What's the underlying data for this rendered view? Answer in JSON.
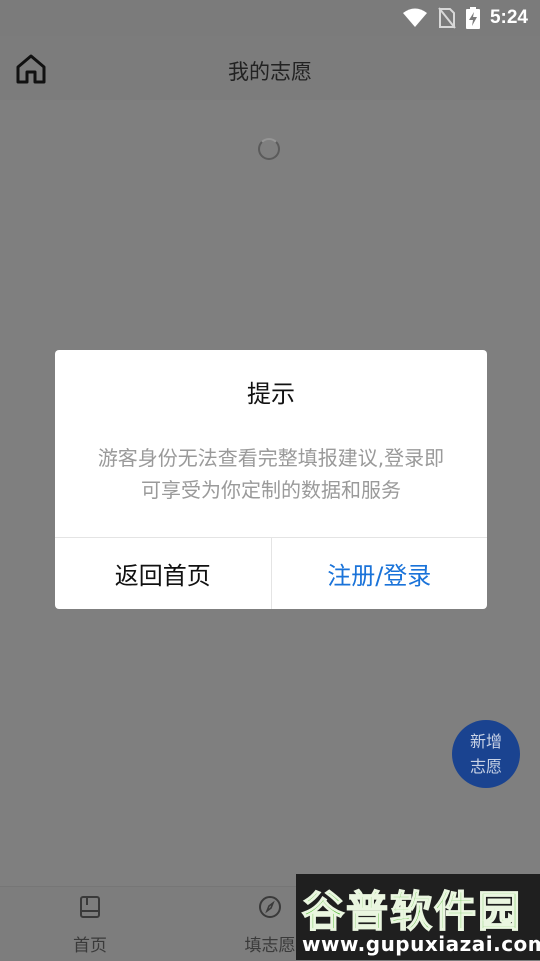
{
  "status_bar": {
    "time": "5:24"
  },
  "header": {
    "title": "我的志愿"
  },
  "fab": {
    "line1": "新增",
    "line2": "志愿"
  },
  "dialog": {
    "title": "提示",
    "message": "游客身份无法查看完整填报建议,登录即可享受为你定制的数据和服务",
    "cancel_label": "返回首页",
    "confirm_label": "注册/登录",
    "confirm_color": "#1a73d9"
  },
  "bottom_nav": {
    "items": [
      {
        "label": "首页",
        "icon": "book-icon"
      },
      {
        "label": "填志愿",
        "icon": "compass-icon"
      }
    ]
  },
  "watermark": {
    "brand": "谷普软件园",
    "url": "www.gupuxiazai.com"
  }
}
